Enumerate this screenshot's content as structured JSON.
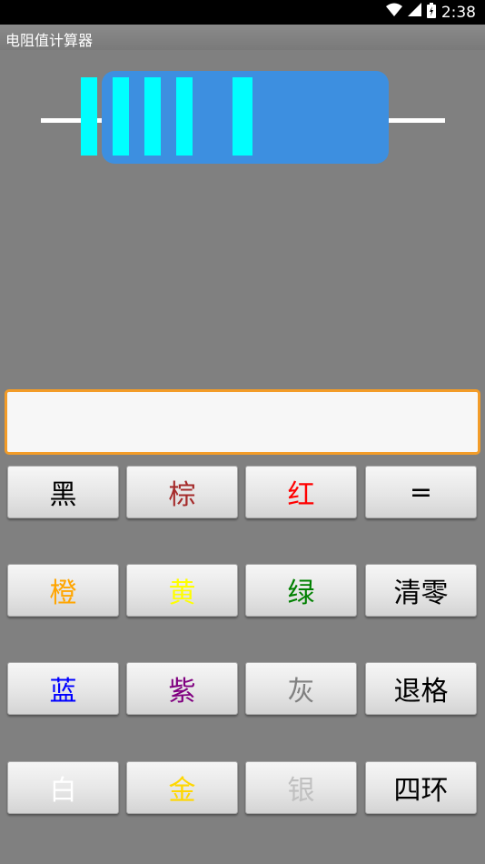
{
  "status_bar": {
    "time": "2:38",
    "icons": [
      "wifi-icon",
      "cell-signal-icon",
      "battery-icon"
    ]
  },
  "app": {
    "title": "电阻值计算器"
  },
  "resistor": {
    "body_color": "#3d8fe0",
    "band_color": "#00ffff",
    "lead_color": "#ffffff",
    "bands": 5
  },
  "display": {
    "value": "",
    "placeholder": "",
    "border_color": "#f39c28"
  },
  "keypad": {
    "black": {
      "label": "黑",
      "color": "#000000"
    },
    "brown": {
      "label": "棕",
      "color": "#a52a2a"
    },
    "red": {
      "label": "红",
      "color": "#ff0000"
    },
    "equals": {
      "label": "=",
      "color": "#000000"
    },
    "orange": {
      "label": "橙",
      "color": "#ffa500"
    },
    "yellow": {
      "label": "黄",
      "color": "#ffff00"
    },
    "green": {
      "label": "绿",
      "color": "#008000"
    },
    "clear": {
      "label": "清零",
      "color": "#000000"
    },
    "blue": {
      "label": "蓝",
      "color": "#0000ff"
    },
    "purple": {
      "label": "紫",
      "color": "#800080"
    },
    "gray": {
      "label": "灰",
      "color": "#808080"
    },
    "backspace": {
      "label": "退格",
      "color": "#000000"
    },
    "white": {
      "label": "白",
      "color": "#ffffff"
    },
    "gold": {
      "label": "金",
      "color": "#ffd700"
    },
    "silver": {
      "label": "银",
      "color": "#c0c0c0"
    },
    "four_band": {
      "label": "四环",
      "color": "#000000"
    }
  }
}
